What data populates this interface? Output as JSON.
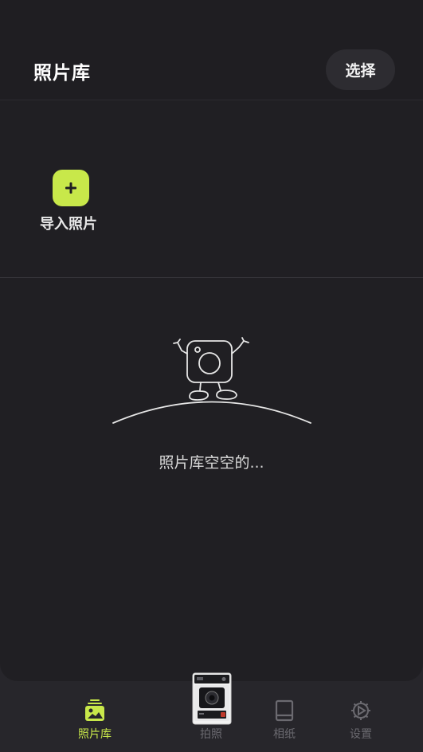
{
  "header": {
    "title": "照片库",
    "select_label": "选择"
  },
  "import": {
    "label": "导入照片",
    "icon": "plus-icon"
  },
  "empty_state": {
    "text": "照片库空空的...",
    "illustration": "camera-mascot-illustration"
  },
  "tabbar": {
    "tabs": [
      {
        "label": "照片库",
        "icon": "gallery-icon",
        "active": true
      },
      {
        "label": "拍照",
        "icon": "camera-icon",
        "active": false
      },
      {
        "label": "相纸",
        "icon": "photo-paper-icon",
        "active": false
      },
      {
        "label": "设置",
        "icon": "gear-icon",
        "active": false
      }
    ]
  },
  "colors": {
    "accent": "#c8e84a",
    "background": "#201f23",
    "tabbar_background": "#27262b",
    "inactive": "#6b6a70"
  }
}
